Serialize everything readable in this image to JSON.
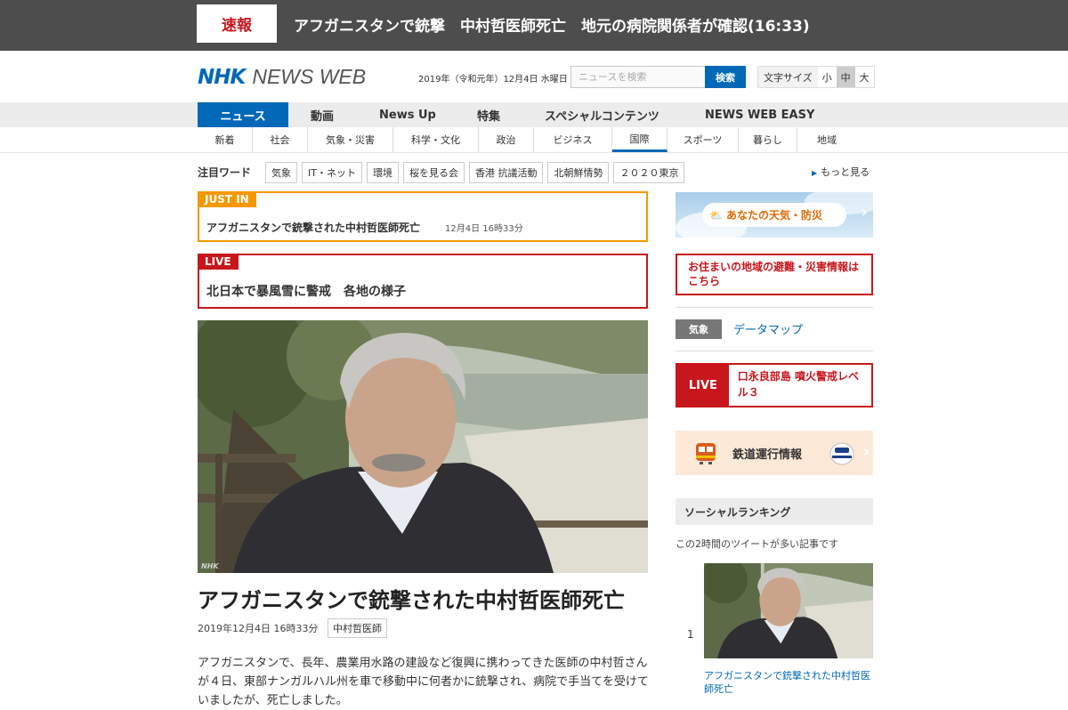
{
  "breaking": {
    "badge": "速報",
    "headline": "アフガニスタンで銃撃　中村哲医師死亡　地元の病院関係者が確認(16:33)"
  },
  "header": {
    "logo_nhk": "NHK",
    "logo_news": "NEWS WEB",
    "date": "2019年（令和元年）12月4日 水曜日",
    "search_placeholder": "ニュースを検索",
    "search_button": "検索",
    "fontsize_label": "文字サイズ",
    "fontsize_options": [
      "小",
      "中",
      "大"
    ]
  },
  "mainnav": [
    "ニュース",
    "動画",
    "News Up",
    "特集",
    "スペシャルコンテンツ",
    "NEWS WEB EASY"
  ],
  "subnav": [
    "新着",
    "社会",
    "気象・災害",
    "科学・文化",
    "政治",
    "ビジネス",
    "国際",
    "スポーツ",
    "暮らし",
    "地域"
  ],
  "trending": {
    "label": "注目ワード",
    "tags": [
      "気象",
      "IT・ネット",
      "環境",
      "桜を見る会",
      "香港 抗議活動",
      "北朝鮮情勢",
      "２０２０東京"
    ],
    "more": "もっと見る"
  },
  "justin": {
    "label": "JUST IN",
    "title": "アフガニスタンで銃撃された中村哲医師死亡",
    "time": "12月4日 16時33分"
  },
  "live": {
    "label": "LIVE",
    "title": "北日本で暴風雪に警戒　各地の様子"
  },
  "article": {
    "watermark": "NHK",
    "title": "アフガニスタンで銃撃された中村哲医師死亡",
    "date": "2019年12月4日 16時33分",
    "tag": "中村哲医師",
    "body": "アフガニスタンで、長年、農業用水路の建設など復興に携わってきた医師の中村哲さんが４日、東部ナンガルハル州を車で移動中に何者かに銃撃され、病院で手当てを受けていましたが、死亡しました。"
  },
  "sidebar": {
    "weather": "あなたの天気・防災",
    "evac": "お住まいの地域の避難・災害情報はこちら",
    "kisho": "気象",
    "datamap": "データマップ",
    "volcano_label": "LIVE",
    "volcano_text": "口永良部島 噴火警戒レベル３",
    "rail": "鉄道運行情報",
    "ranking_head": "ソーシャルランキング",
    "ranking_sub": "この2時間のツイートが多い記事です",
    "ranking_num": "1",
    "ranking_title": "アフガニスタンで銃撃された中村哲医師死亡"
  },
  "colors": {
    "brand": "#0068b7",
    "alert": "#c8161d",
    "justin": "#f39800"
  }
}
